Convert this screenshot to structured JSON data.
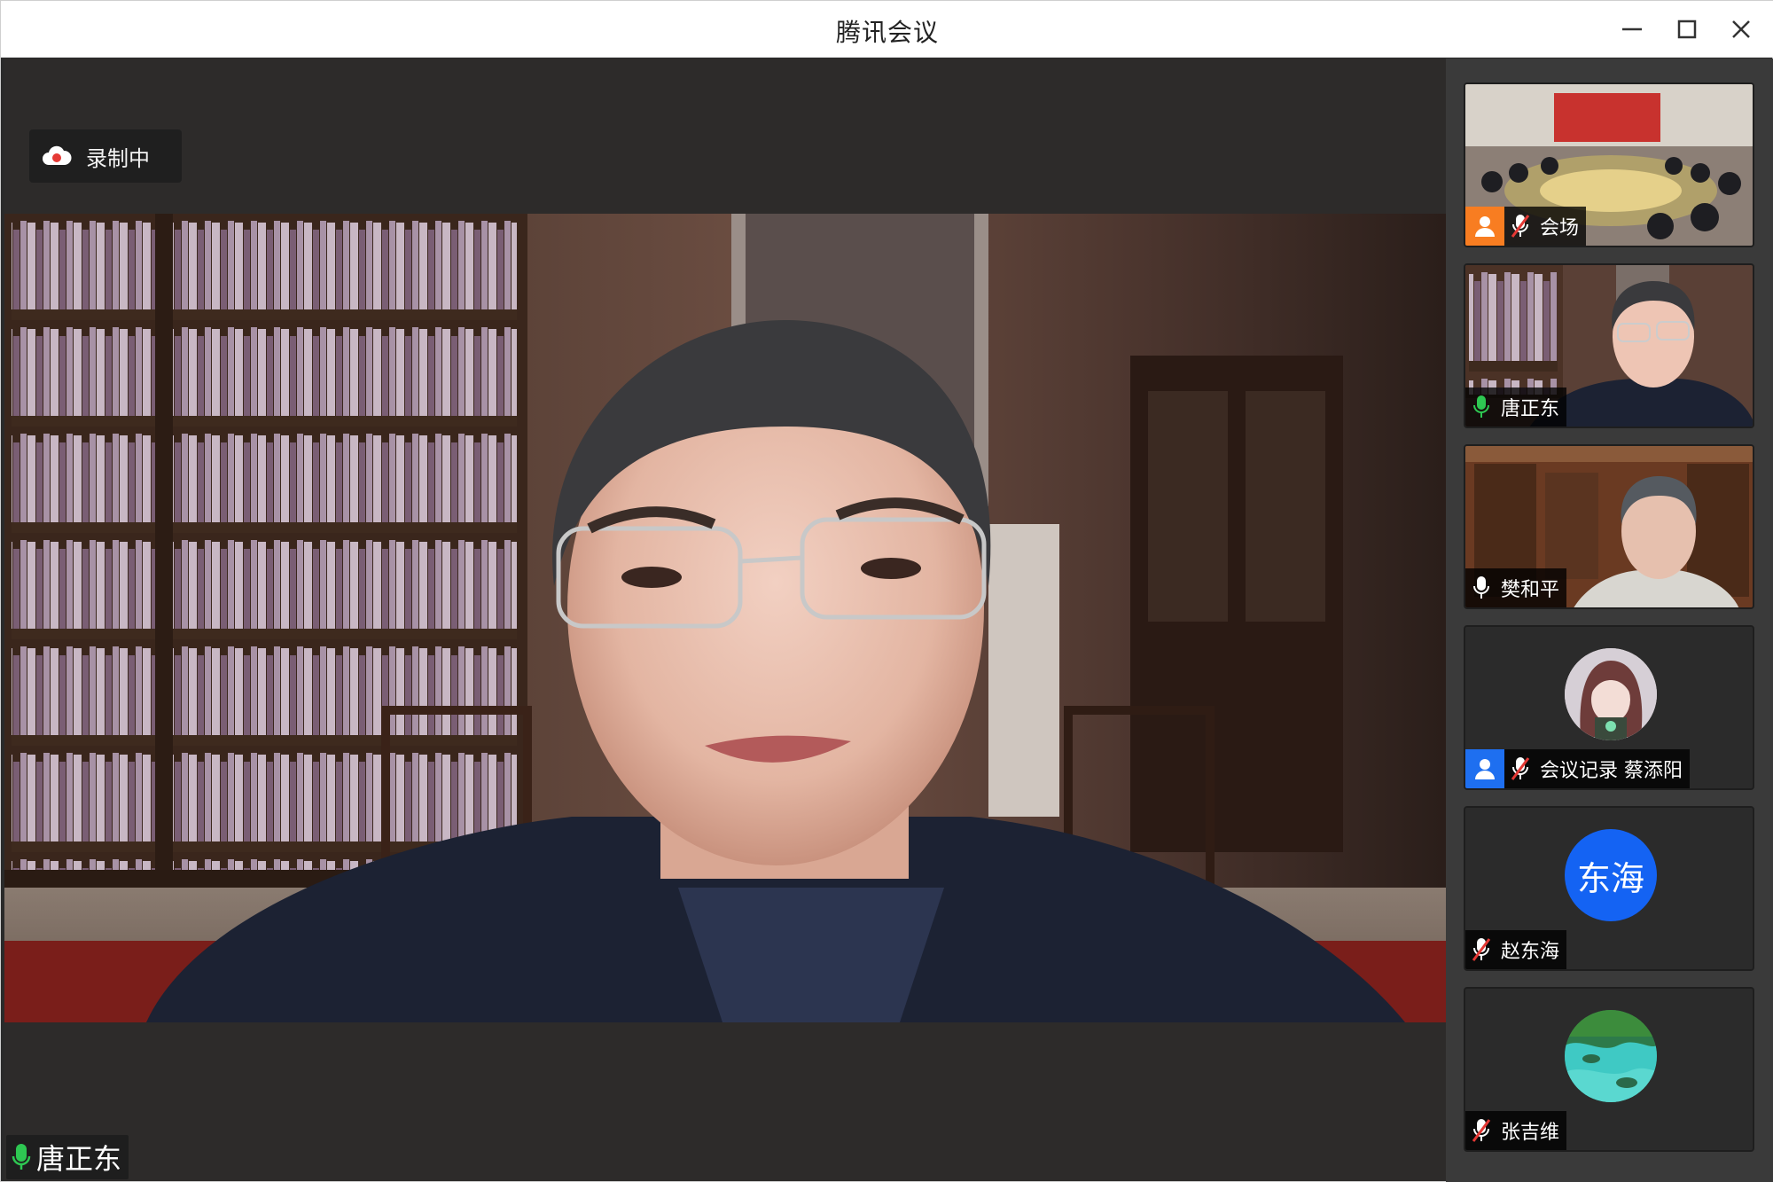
{
  "window": {
    "title": "腾讯会议"
  },
  "recording": {
    "label": "录制中"
  },
  "main": {
    "speaker_name": "唐正东",
    "speaker_mic": "active"
  },
  "participants": [
    {
      "name": "会场",
      "badge": "host",
      "badge_color": "#f87d21",
      "mic": "muted"
    },
    {
      "name": "唐正东",
      "badge": "none",
      "mic": "active"
    },
    {
      "name": "樊和平",
      "badge": "none",
      "mic": "on"
    },
    {
      "name": "会议记录 蔡添阳",
      "badge": "cohost",
      "badge_color": "#1e6ff0",
      "mic": "muted",
      "avatar": "anime-girl-avatar"
    },
    {
      "name": "赵东海",
      "badge": "none",
      "mic": "muted",
      "avatar_text": "东海",
      "avatar_color": "#1463f3"
    },
    {
      "name": "张吉维",
      "badge": "none",
      "mic": "muted",
      "avatar": "landscape-avatar"
    }
  ],
  "colors": {
    "mic_active": "#2ec752",
    "stage_bg": "#2d2b2a",
    "sidebar_bg": "#3a3a3a"
  }
}
